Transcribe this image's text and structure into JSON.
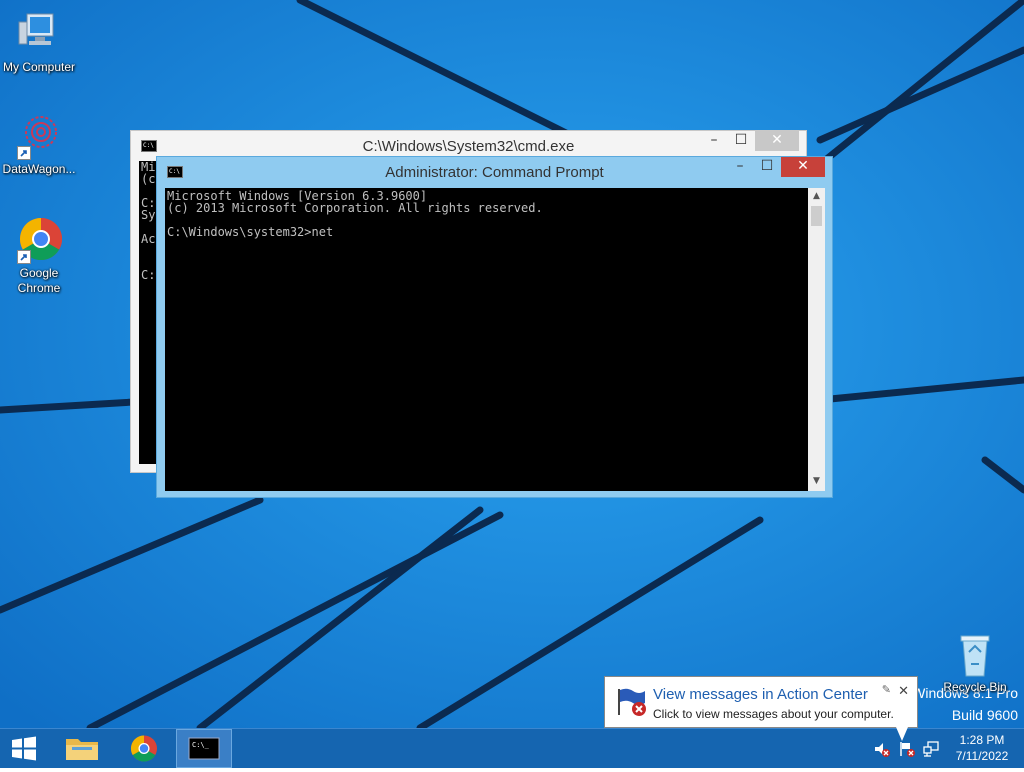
{
  "desktop_icons": [
    {
      "label": "My Computer",
      "icon": "computer-icon"
    },
    {
      "label": "DataWagon...",
      "icon": "gear-flower-icon"
    },
    {
      "label": "Google Chrome",
      "icon": "chrome-icon"
    },
    {
      "label": "Recycle Bin",
      "icon": "recycle-bin-icon"
    }
  ],
  "back_window": {
    "title": "C:\\Windows\\System32\\cmd.exe",
    "console_fragment": "Mi\n(c\n\nC:\nSy\n\nAc\n\n\nC:"
  },
  "front_window": {
    "title": "Administrator: Command Prompt",
    "console_text": "Microsoft Windows [Version 6.3.9600]\n(c) 2013 Microsoft Corporation. All rights reserved.\n\nC:\\Windows\\system32>net"
  },
  "window_controls": {
    "minimize": "–",
    "maximize": "☐",
    "close": "✕"
  },
  "watermark": {
    "line1": "Windows 8.1 Pro",
    "line2": "Build 9600"
  },
  "balloon": {
    "title": "View messages in Action Center",
    "message": "Click to view messages about your computer.",
    "close": "✕"
  },
  "taskbar": {
    "buttons": [
      "start-button",
      "file-explorer-button",
      "chrome-button",
      "command-prompt-button"
    ],
    "clock_time": "1:28 PM",
    "clock_date": "7/11/2022"
  },
  "colors": {
    "desktop": "#1a87dd",
    "taskbar": "#1565b0",
    "active_title": "#8fcbf0",
    "close_red": "#c7413a"
  }
}
